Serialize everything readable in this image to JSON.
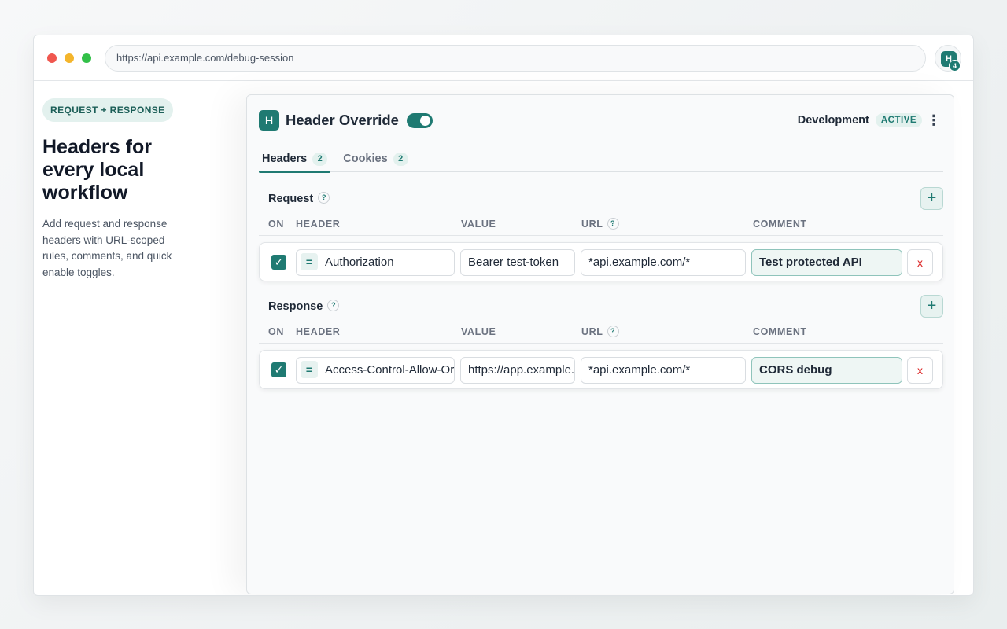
{
  "browser": {
    "url": "https://api.example.com/debug-session",
    "extension_logo": "H",
    "extension_badge": "4"
  },
  "hero": {
    "pill": "REQUEST + RESPONSE",
    "title": "Headers for every local workflow",
    "description": "Add request and response headers with URL-scoped rules, comments, and quick enable toggles."
  },
  "panel": {
    "logo": "H",
    "title": "Header Override",
    "enabled": true,
    "environment": "Development",
    "environment_status": "ACTIVE",
    "menu_icon": "⋮",
    "tabs": [
      {
        "label": "Headers",
        "count": "2",
        "active": true
      },
      {
        "label": "Cookies",
        "count": "2",
        "active": false
      }
    ]
  },
  "columns": {
    "on": "ON",
    "header": "HEADER",
    "value": "VALUE",
    "url": "URL",
    "comment": "COMMENT",
    "help": "?"
  },
  "request": {
    "title": "Request",
    "add_label": "+",
    "rows": [
      {
        "enabled": true,
        "check": "✓",
        "op": "=",
        "header": "Authorization",
        "value": "Bearer test-token",
        "url": "*api.example.com/*",
        "comment": "Test protected API",
        "delete": "x"
      }
    ]
  },
  "response": {
    "title": "Response",
    "add_label": "+",
    "rows": [
      {
        "enabled": true,
        "check": "✓",
        "op": "=",
        "header": "Access-Control-Allow-Origin",
        "value": "https://app.example.com",
        "url": "*api.example.com/*",
        "comment": "CORS debug",
        "delete": "x"
      }
    ]
  },
  "colors": {
    "accent": "#1f7a72",
    "accent_light": "#e3f1ee",
    "danger": "#dc2626"
  }
}
